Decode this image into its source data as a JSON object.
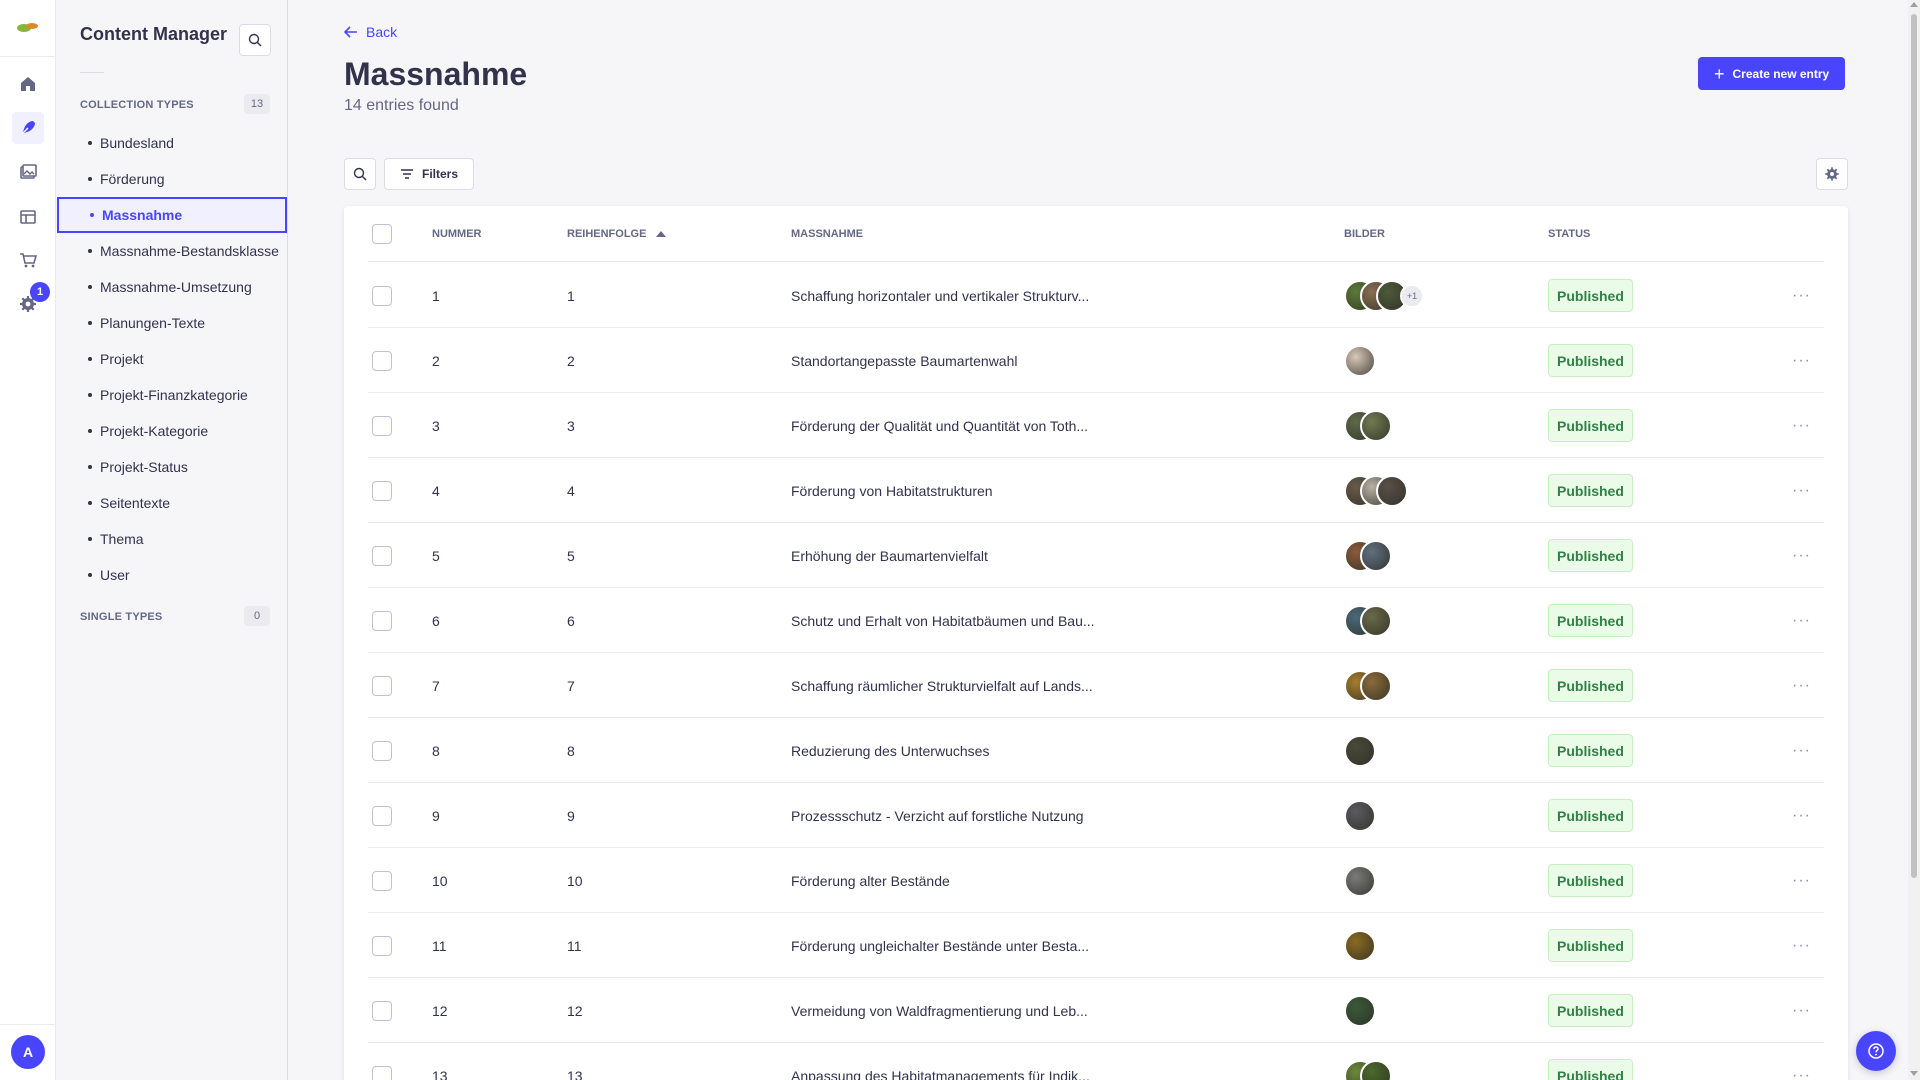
{
  "rail": {
    "icons": [
      "logo",
      "home-icon",
      "content-manager-icon",
      "media-library-icon",
      "content-type-builder-icon",
      "marketplace-icon",
      "settings-icon"
    ],
    "settings_badge": "1",
    "avatar_initial": "A"
  },
  "subnav": {
    "title": "Content Manager",
    "collection_label": "COLLECTION TYPES",
    "collection_count": "13",
    "single_label": "SINGLE TYPES",
    "single_count": "0",
    "items": [
      {
        "label": "Bundesland"
      },
      {
        "label": "Förderung"
      },
      {
        "label": "Massnahme"
      },
      {
        "label": "Massnahme-Bestandsklasse"
      },
      {
        "label": "Massnahme-Umsetzung"
      },
      {
        "label": "Planungen-Texte"
      },
      {
        "label": "Projekt"
      },
      {
        "label": "Projekt-Finanzkategorie"
      },
      {
        "label": "Projekt-Kategorie"
      },
      {
        "label": "Projekt-Status"
      },
      {
        "label": "Seitentexte"
      },
      {
        "label": "Thema"
      },
      {
        "label": "User"
      }
    ],
    "active_item": "Massnahme"
  },
  "header": {
    "back_label": "Back",
    "title": "Massnahme",
    "subtitle": "14 entries found",
    "create_label": "Create new entry"
  },
  "toolbar": {
    "filters_label": "Filters"
  },
  "table": {
    "columns": {
      "nummer": "NUMMER",
      "reihenfolge": "REIHENFOLGE",
      "massnahme": "MASSNAHME",
      "bilder": "BILDER",
      "status": "STATUS"
    },
    "rows": [
      {
        "nummer": "1",
        "reihenfolge": "1",
        "massnahme": "Schaffung horizontaler und vertikaler Strukturv...",
        "images": [
          "#5c7a3a",
          "#8a6e52",
          "#4d5a3a"
        ],
        "more": "+1",
        "status": "Published"
      },
      {
        "nummer": "2",
        "reihenfolge": "2",
        "massnahme": "Standortangepasste Baumartenwahl",
        "images": [
          "#d8c8b8"
        ],
        "more": "",
        "status": "Published"
      },
      {
        "nummer": "3",
        "reihenfolge": "3",
        "massnahme": "Förderung der Qualität und Quantität von Toth...",
        "images": [
          "#5d6a4a",
          "#6f7a50"
        ],
        "more": "",
        "status": "Published"
      },
      {
        "nummer": "4",
        "reihenfolge": "4",
        "massnahme": "Förderung von Habitatstrukturen",
        "images": [
          "#6a5a48",
          "#b8b0a4",
          "#5a5048"
        ],
        "more": "",
        "status": "Published"
      },
      {
        "nummer": "5",
        "reihenfolge": "5",
        "massnahme": "Erhöhung der Baumartenvielfalt",
        "images": [
          "#8a5a3a",
          "#5f6f7f"
        ],
        "more": "",
        "status": "Published"
      },
      {
        "nummer": "6",
        "reihenfolge": "6",
        "massnahme": "Schutz und Erhalt von Habitatbäumen und Bau...",
        "images": [
          "#4a6a7a",
          "#6a6a4a"
        ],
        "more": "",
        "status": "Published"
      },
      {
        "nummer": "7",
        "reihenfolge": "7",
        "massnahme": "Schaffung räumlicher Strukturvielfalt auf Lands...",
        "images": [
          "#a67c2e",
          "#8a6a3a"
        ],
        "more": "",
        "status": "Published"
      },
      {
        "nummer": "8",
        "reihenfolge": "8",
        "massnahme": "Reduzierung des Unterwuchses",
        "images": [
          "#4a4a3a"
        ],
        "more": "",
        "status": "Published"
      },
      {
        "nummer": "9",
        "reihenfolge": "9",
        "massnahme": "Prozessschutz - Verzicht auf forstliche Nutzung",
        "images": [
          "#5a5a60"
        ],
        "more": "",
        "status": "Published"
      },
      {
        "nummer": "10",
        "reihenfolge": "10",
        "massnahme": "Förderung alter Bestände",
        "images": [
          "#7a7a7a"
        ],
        "more": "",
        "status": "Published"
      },
      {
        "nummer": "11",
        "reihenfolge": "11",
        "massnahme": "Förderung ungleichalter Bestände unter Besta...",
        "images": [
          "#8a6a20"
        ],
        "more": "",
        "status": "Published"
      },
      {
        "nummer": "12",
        "reihenfolge": "12",
        "massnahme": "Vermeidung von Waldfragmentierung und Leb...",
        "images": [
          "#3a5a3a"
        ],
        "more": "",
        "status": "Published"
      },
      {
        "nummer": "13",
        "reihenfolge": "13",
        "massnahme": "Anpassung des Habitatmanagements für Indik...",
        "images": [
          "#6a8a3a",
          "#4a6a2a"
        ],
        "more": "",
        "status": "Published"
      }
    ]
  },
  "colors": {
    "primary": "#4945ff",
    "success_text": "#328048",
    "success_bg": "#eafbe7"
  }
}
